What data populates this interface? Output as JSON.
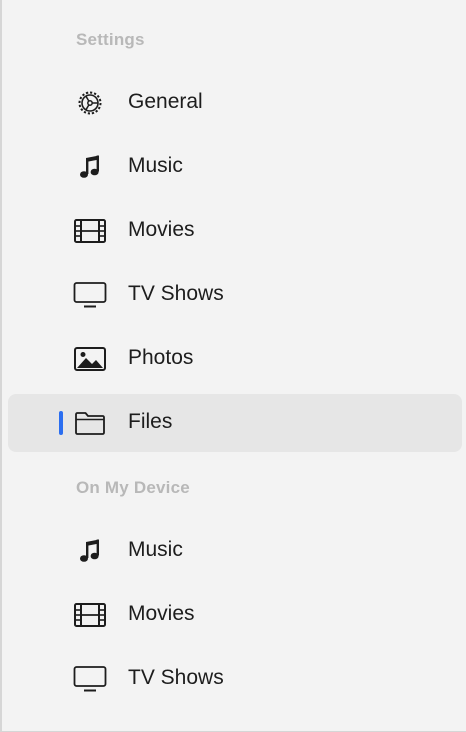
{
  "sections": [
    {
      "header": "Settings",
      "items": [
        {
          "label": "General",
          "icon": "gear-icon"
        },
        {
          "label": "Music",
          "icon": "music-note-icon"
        },
        {
          "label": "Movies",
          "icon": "film-icon"
        },
        {
          "label": "TV Shows",
          "icon": "tv-icon"
        },
        {
          "label": "Photos",
          "icon": "photo-icon"
        },
        {
          "label": "Files",
          "icon": "folder-icon",
          "selected": true
        }
      ]
    },
    {
      "header": "On My Device",
      "items": [
        {
          "label": "Music",
          "icon": "music-note-icon"
        },
        {
          "label": "Movies",
          "icon": "film-icon"
        },
        {
          "label": "TV Shows",
          "icon": "tv-icon"
        }
      ]
    }
  ],
  "colors": {
    "background": "#f3f3f3",
    "selected_background": "#e6e6e6",
    "selection_indicator": "#2b6ef0",
    "section_header": "#b8b8b8",
    "label": "#1d1d1d"
  }
}
